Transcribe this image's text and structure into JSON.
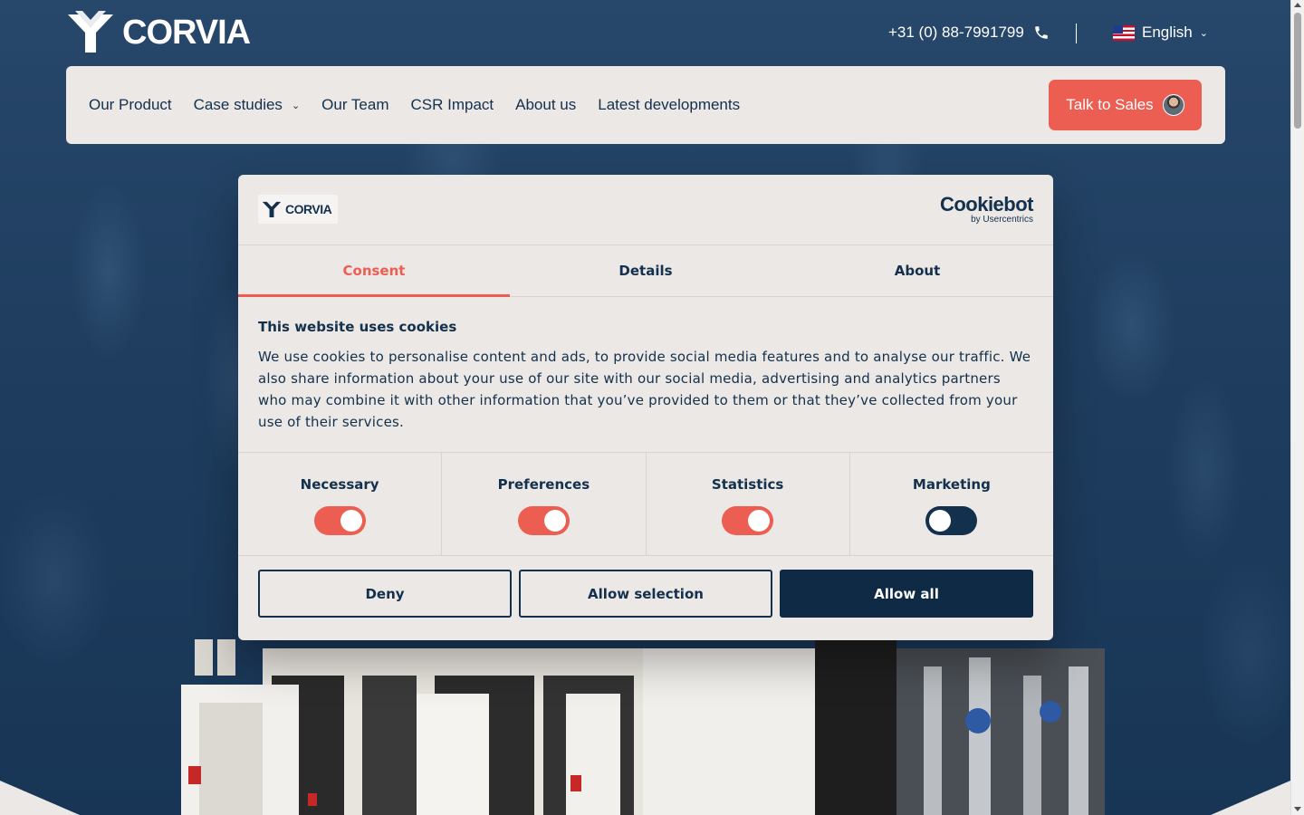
{
  "brand": {
    "name": "CORVIA"
  },
  "topbar": {
    "phone": "+31 (0) 88-7991799",
    "language": "English"
  },
  "nav": {
    "items": [
      {
        "label": "Our Product",
        "dropdown": false
      },
      {
        "label": "Case studies",
        "dropdown": true
      },
      {
        "label": "Our Team",
        "dropdown": false
      },
      {
        "label": "CSR Impact",
        "dropdown": false
      },
      {
        "label": "About us",
        "dropdown": false
      },
      {
        "label": "Latest developments",
        "dropdown": false
      }
    ],
    "cta": "Talk to Sales"
  },
  "dialog": {
    "brand": "CORVIA",
    "provider": {
      "name": "Cookiebot",
      "sub": "by Usercentrics"
    },
    "tabs": [
      {
        "label": "Consent",
        "active": true
      },
      {
        "label": "Details",
        "active": false
      },
      {
        "label": "About",
        "active": false
      }
    ],
    "title": "This website uses cookies",
    "text": "We use cookies to personalise content and ads, to provide social media features and to analyse our traffic. We also share information about your use of our site with our social media, advertising and analytics partners who may combine it with other information that you’ve provided to them or that they’ve collected from your use of their services.",
    "toggles": [
      {
        "label": "Necessary",
        "on": true
      },
      {
        "label": "Preferences",
        "on": true
      },
      {
        "label": "Statistics",
        "on": true
      },
      {
        "label": "Marketing",
        "on": false
      }
    ],
    "buttons": {
      "deny": "Deny",
      "selection": "Allow selection",
      "all": "Allow all"
    }
  },
  "colors": {
    "accent": "#ec5e52",
    "navy": "#13304d",
    "panel": "#ece8e5"
  },
  "icons": {
    "phone": "phone-icon",
    "flag": "us-flag-icon",
    "chevron": "chevron-down-icon"
  }
}
